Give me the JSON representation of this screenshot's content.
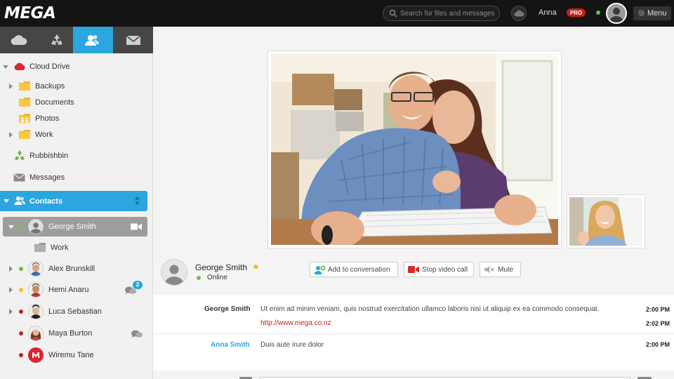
{
  "app": {
    "logo": "MEGA"
  },
  "header": {
    "search_placeholder": "Search for files and messages",
    "user_name": "Anna",
    "pro_label": "PRO",
    "menu_label": "Menu"
  },
  "sidebar": {
    "tabs": [
      {
        "id": "cloud",
        "icon": "cloud-icon"
      },
      {
        "id": "rubbish",
        "icon": "recycle-icon"
      },
      {
        "id": "contacts",
        "icon": "contacts-icon",
        "active": true
      },
      {
        "id": "messages",
        "icon": "envelope-icon"
      }
    ],
    "tree": {
      "cloud_drive": "Cloud Drive",
      "backups": "Backups",
      "documents": "Documents",
      "photos": "Photos",
      "work": "Work",
      "rubbish_bin": "Rubbishbin",
      "messages": "Messages"
    },
    "contacts_header": "Contacts",
    "contacts": [
      {
        "name": "George Smith",
        "status": "online",
        "selected": true
      },
      {
        "name": "Alex Brunskill",
        "status": "online"
      },
      {
        "name": "Hemi Anaru",
        "status": "away",
        "unread": "2"
      },
      {
        "name": "Luca Sebastian",
        "status": "busy"
      },
      {
        "name": "Maya Burton",
        "status": "busy"
      },
      {
        "name": "Wiremu Tane",
        "status": "busy"
      }
    ],
    "george_subfolder": "Work"
  },
  "call": {
    "peer_name": "George Smith",
    "peer_status": "Online",
    "add_label": "Add to conversation",
    "stop_video_label": "Stop video call",
    "mute_label": "Mute"
  },
  "messages": [
    {
      "sender": "George Smith",
      "text": "Ut enim ad minim veniam, quis nostrud exercitation ullamco laboris nisi ut aliquip ex ea commodo consequat.",
      "time": "2:00 PM",
      "link": "http://www.mega.co.nz",
      "link_time": "2:02 PM"
    },
    {
      "sender": "Anna Smith",
      "text": "Duis aute irure dolor",
      "time": "2:00 PM"
    }
  ],
  "colors": {
    "accent": "#2ba6de",
    "brand_red": "#c0211a",
    "online": "#6fbf3f",
    "away": "#f0c419",
    "busy": "#c0211a"
  }
}
